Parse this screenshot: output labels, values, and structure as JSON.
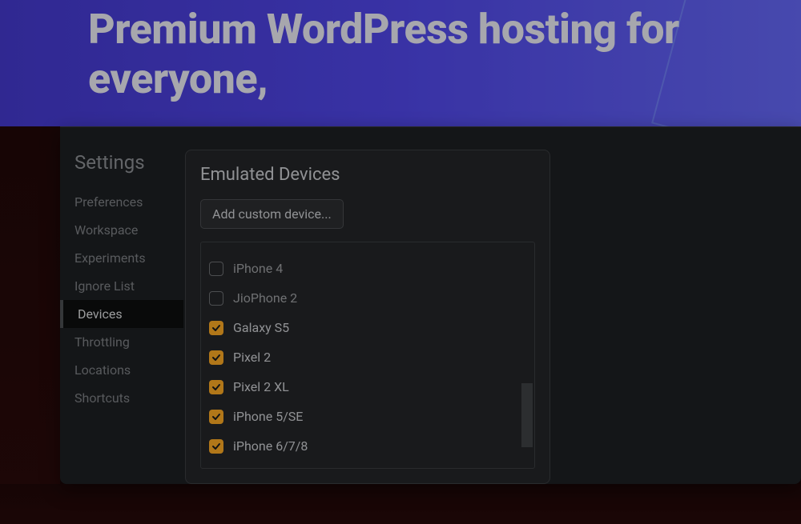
{
  "banner": {
    "text": "Premium WordPress hosting for everyone,"
  },
  "sidebar": {
    "title": "Settings",
    "items": [
      {
        "label": "Preferences",
        "active": false
      },
      {
        "label": "Workspace",
        "active": false
      },
      {
        "label": "Experiments",
        "active": false
      },
      {
        "label": "Ignore List",
        "active": false
      },
      {
        "label": "Devices",
        "active": true
      },
      {
        "label": "Throttling",
        "active": false
      },
      {
        "label": "Locations",
        "active": false
      },
      {
        "label": "Shortcuts",
        "active": false
      }
    ]
  },
  "panel": {
    "title": "Emulated Devices",
    "add_button_label": "Add custom device...",
    "devices": [
      {
        "label": "iPhone 4",
        "checked": false
      },
      {
        "label": "JioPhone 2",
        "checked": false
      },
      {
        "label": "Galaxy S5",
        "checked": true
      },
      {
        "label": "Pixel 2",
        "checked": true
      },
      {
        "label": "Pixel 2 XL",
        "checked": true
      },
      {
        "label": "iPhone 5/SE",
        "checked": true
      },
      {
        "label": "iPhone 6/7/8",
        "checked": true
      }
    ]
  }
}
